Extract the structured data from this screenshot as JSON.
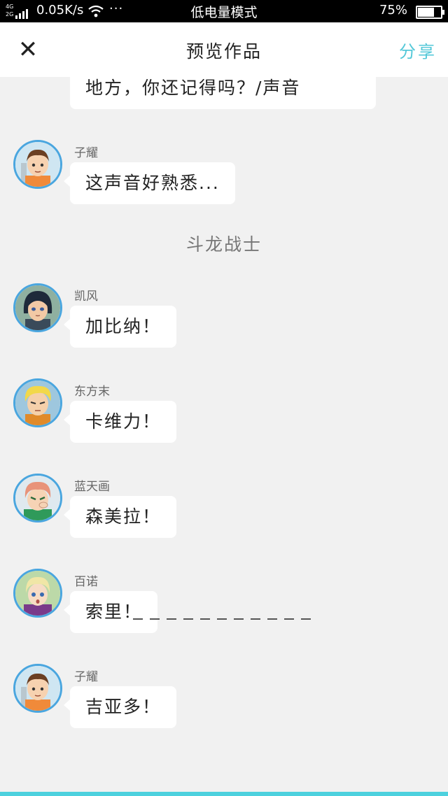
{
  "status_bar": {
    "network": "4G 2G",
    "speed": "0.05K/s",
    "more": "···",
    "mode": "低电量模式",
    "battery_percent": "75%",
    "battery_level": 0.75
  },
  "header": {
    "close_icon": "close-icon",
    "title": "预览作品",
    "share_label": "分享"
  },
  "colors": {
    "accent": "#54c8d8",
    "avatar_ring": "#4aa6df",
    "background": "#f1f1f1",
    "bottom_bar": "#4dd1de"
  },
  "messages": [
    {
      "text": "地方，你还记得吗？/声音"
    },
    {
      "name": "子耀",
      "text": "这声音好熟悉...",
      "avatar": "boy-brown-hair"
    },
    {
      "section": "斗龙战士"
    },
    {
      "name": "凯风",
      "text": "加比纳！",
      "avatar": "boy-dark-hair"
    },
    {
      "name": "东方末",
      "text": "卡维力！",
      "avatar": "boy-blonde-hair"
    },
    {
      "name": "蓝天画",
      "text": "森美拉！",
      "avatar": "girl-pink-hair"
    },
    {
      "name": "百诺",
      "text": "索里！",
      "avatar": "boy-light-hair"
    },
    {
      "name": "子耀",
      "text": "吉亚多！",
      "avatar": "boy-brown-hair"
    }
  ]
}
